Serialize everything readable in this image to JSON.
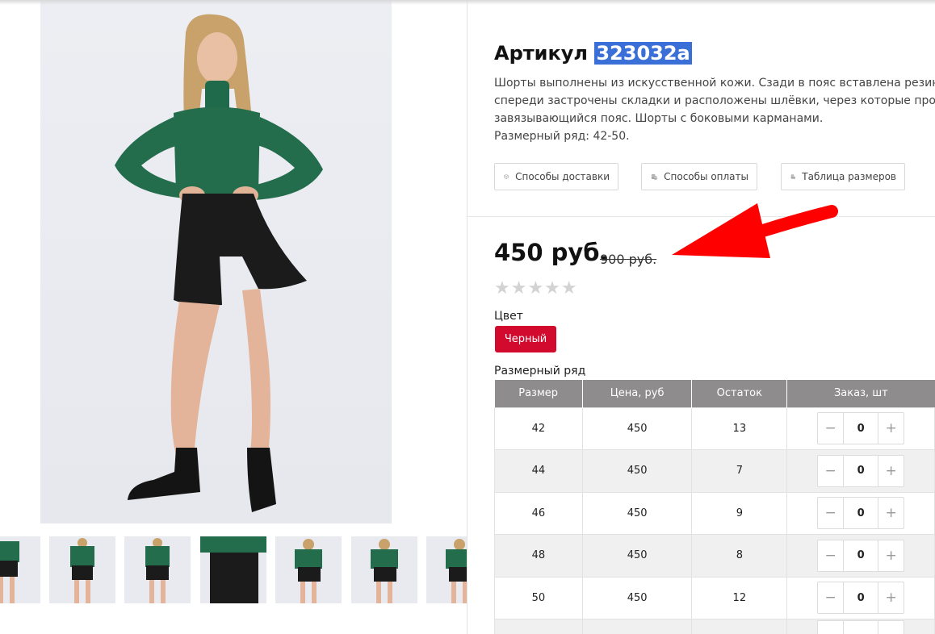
{
  "product": {
    "title_prefix": "Артикул",
    "sku": "323032а",
    "description_lines": [
      "Шорты выполнены из искусственной кожи. Сзади в пояс вставлена резина,",
      "спереди застрочены складки и расположены шлёвки, через которые продёрнут",
      "завязывающийся пояс. Шорты с боковыми карманами.",
      "Размерный ряд: 42-50."
    ]
  },
  "info_buttons": {
    "delivery": "Способы доставки",
    "payment": "Способы оплаты",
    "sizes": "Таблица размеров"
  },
  "pricing": {
    "price": "450 руб.",
    "old_price": "900 руб."
  },
  "rating": {
    "stars": "★★★★★",
    "value": 0,
    "max": 5
  },
  "color": {
    "label": "Цвет",
    "selected": "Черный",
    "accent": "#d20a2e"
  },
  "size_grid": {
    "label": "Размерный ряд",
    "headers": [
      "Размер",
      "Цена, руб",
      "Остаток",
      "Заказ, шт"
    ],
    "rows": [
      {
        "size": "42",
        "price": "450",
        "stock": "13",
        "qty": "0"
      },
      {
        "size": "44",
        "price": "450",
        "stock": "7",
        "qty": "0"
      },
      {
        "size": "46",
        "price": "450",
        "stock": "9",
        "qty": "0"
      },
      {
        "size": "48",
        "price": "450",
        "stock": "8",
        "qty": "0"
      },
      {
        "size": "50",
        "price": "450",
        "stock": "12",
        "qty": "0"
      }
    ],
    "minus": "−",
    "plus": "+"
  },
  "colors": {
    "sku_highlight": "#3a6fd8",
    "table_header": "#8e8c8c",
    "annotation_arrow": "#ff0000"
  },
  "icons": {
    "delivery": "box-icon",
    "payment": "coins-icon",
    "sizes": "coins-stack-icon"
  }
}
